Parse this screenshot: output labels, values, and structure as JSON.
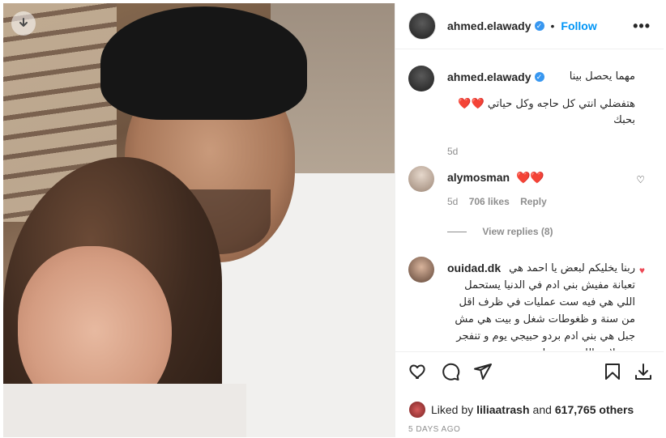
{
  "post": {
    "username": "ahmed.elawady",
    "follow_label": "Follow",
    "separator": "•",
    "more_label": "•••"
  },
  "caption": {
    "username": "ahmed.elawady",
    "line1": "مهما يحصل بينا",
    "line2": "هتفضلي انتي كل حاجه وكل حياتي ❤️❤️",
    "line3": "بحبك",
    "time": "5d"
  },
  "comments": [
    {
      "username": "alymosman",
      "text": "❤️❤️",
      "time": "5d",
      "likes": "706 likes",
      "reply_label": "Reply",
      "view_replies": "View replies (8)"
    },
    {
      "username": "ouidad.dk",
      "text": "ربنا يخليكم لبعض يا احمد هي تعبانة مفيش بني ادم في الدنيا يستحمل اللي هي فيه ست عمليات في ظرف اقل من سنة و ظغوطات شغل و بيت هي مش جبل هي بني ادم بردو حبيجي يوم و تنفجر بس لازم اللي بيحبوها"
    }
  ],
  "likes": {
    "prefix": "Liked by",
    "user": "liliaatrash",
    "joiner": "and",
    "others": "617,765 others"
  },
  "timestamp": "5 DAYS AGO",
  "icons": {
    "download": "download-icon",
    "heart": "heart-icon",
    "comment": "comment-icon",
    "share": "share-icon",
    "save": "bookmark-icon",
    "verified": "verified-badge-icon"
  },
  "colors": {
    "accent": "#0095f6",
    "heart": "#ed4956",
    "muted": "#8e8e8e"
  }
}
